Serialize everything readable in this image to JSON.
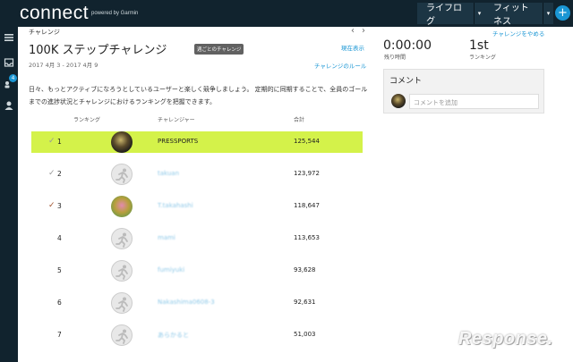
{
  "header": {
    "logo": "connect",
    "powered": "powered by Garmin",
    "nav": [
      {
        "label": "ライフログ"
      },
      {
        "label": "フィットネス"
      }
    ],
    "plus": "+"
  },
  "sidebar": {
    "badge": "4"
  },
  "breadcrumb": "チャレンジ",
  "challenge": {
    "title": "100K ステップチャレンジ",
    "tag": "週ごとのチャレンジ",
    "show_now": "現在表示",
    "dates": "2017 4月 3 - 2017 4月 9",
    "rules_link": "チャレンジのルール",
    "description": "日々、もっとアクティブになろうとしているユーザーと楽しく競争しましょう。 定期的に同期することで、全員のゴールまでの進捗状況とチャレンジにおけるランキングを把握できます。"
  },
  "table": {
    "headers": {
      "rank": "ランキング",
      "challenger": "チャレンジャー",
      "total": "合計"
    },
    "rows": [
      {
        "rank": "1",
        "name": "PRESSPORTS",
        "total": "125,544",
        "check": "✓",
        "highlight": true,
        "avatar": "photo1"
      },
      {
        "rank": "2",
        "name": "takuan",
        "total": "123,972",
        "check": "✓",
        "highlight": false,
        "avatar": "default"
      },
      {
        "rank": "3",
        "name": "T.takahashi",
        "total": "118,647",
        "check": "✓",
        "highlight": false,
        "avatar": "photo3"
      },
      {
        "rank": "4",
        "name": "mami",
        "total": "113,653",
        "check": "",
        "highlight": false,
        "avatar": "default"
      },
      {
        "rank": "5",
        "name": "fumiyuki",
        "total": "93,628",
        "check": "",
        "highlight": false,
        "avatar": "default"
      },
      {
        "rank": "6",
        "name": "Nakashima0608-3",
        "total": "92,631",
        "check": "",
        "highlight": false,
        "avatar": "default"
      },
      {
        "rank": "7",
        "name": "あらかると",
        "total": "51,003",
        "check": "",
        "highlight": false,
        "avatar": "default"
      }
    ]
  },
  "right_panel": {
    "leave": "チャレンジをやめる",
    "time_left": "0:00:00",
    "time_left_label": "残り時間",
    "ranking": "1st",
    "ranking_label": "ランキング",
    "comment_title": "コメント",
    "comment_placeholder": "コメントを追加"
  },
  "watermark": "Response."
}
